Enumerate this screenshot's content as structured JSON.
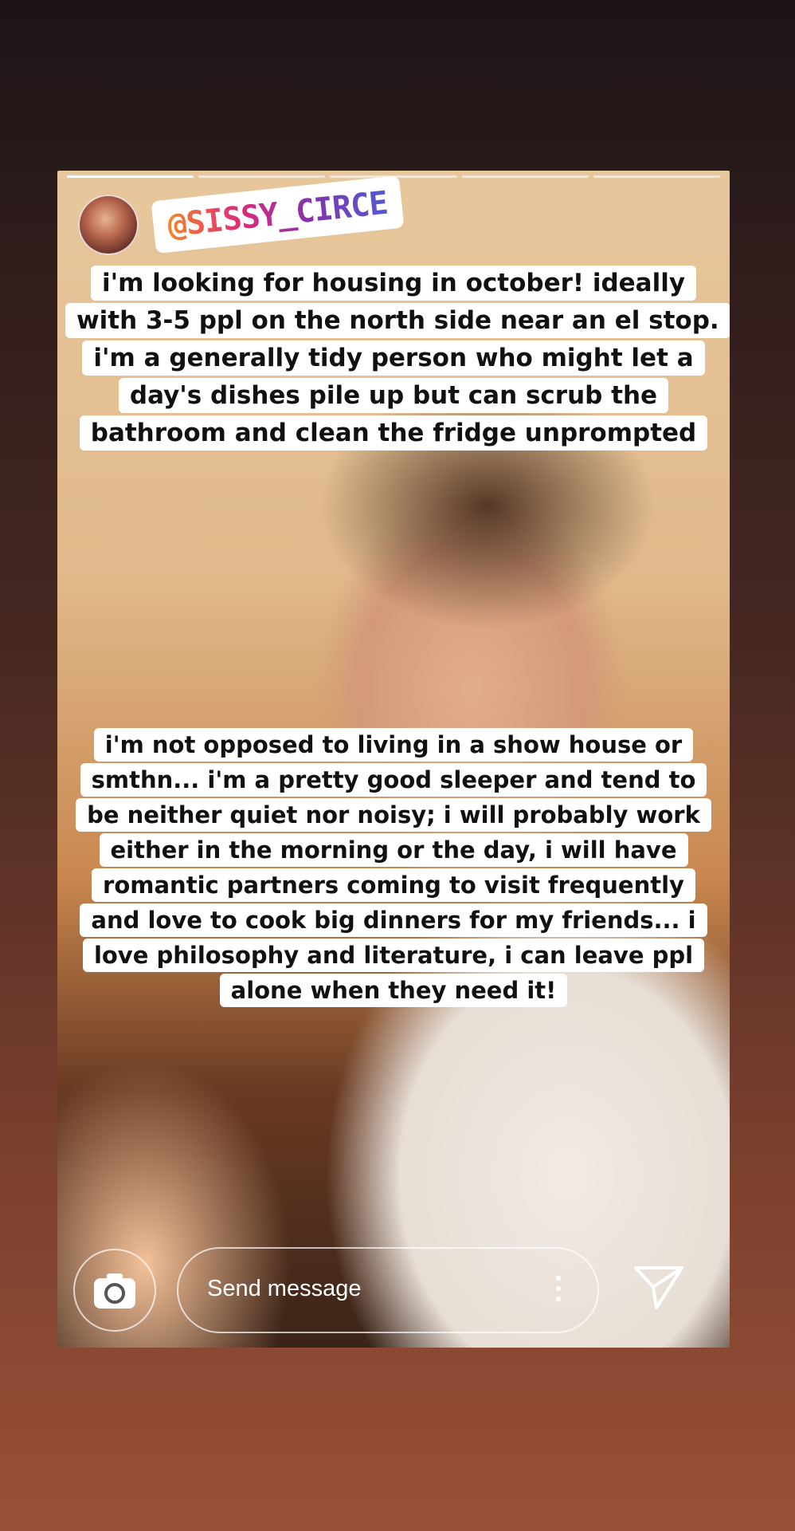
{
  "story": {
    "mention": "@SISSY_CIRCE",
    "caption_1": "i'm looking for housing in october! ideally with 3-5 ppl on the north side near an el stop. i'm a generally tidy person who might let a day's dishes pile up but can scrub the bathroom and clean the fridge unprompted",
    "caption_2": "i'm not opposed to living in a show house or smthn... i'm a pretty good sleeper and tend to be neither quiet nor noisy; i will probably work either in the morning or the day, i will have romantic partners coming to visit frequently and love to cook big dinners for my friends... i love philosophy and literature, i can leave ppl alone when they need it!",
    "progress_segments": 5,
    "active_segment": 1
  },
  "bottom": {
    "message_placeholder": "Send message",
    "camera_icon": "camera-icon",
    "more_icon": "more-vertical-icon",
    "send_icon": "send-icon"
  }
}
